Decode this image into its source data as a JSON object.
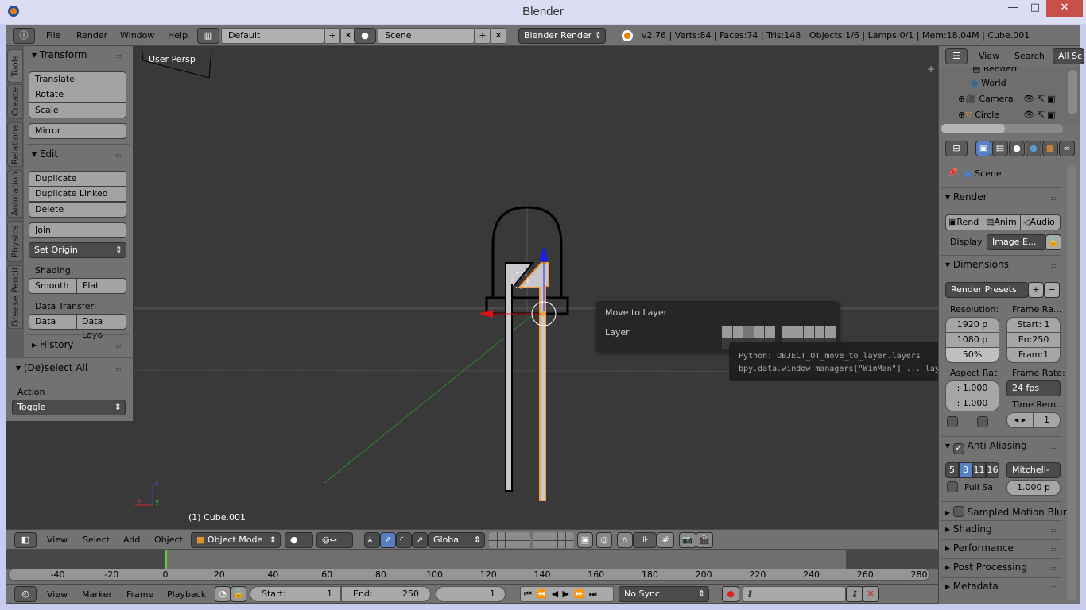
{
  "window": {
    "title": "Blender",
    "minimize": "—",
    "maximize": "□",
    "close": "✕"
  },
  "info_header": {
    "menus": [
      "File",
      "Render",
      "Window",
      "Help"
    ],
    "screen_layout": "Default",
    "scene": "Scene",
    "engine": "Blender Render",
    "stats": "v2.76 | Verts:84 | Faces:74 | Tris:148 | Objects:1/6 | Lamps:0/1 | Mem:18.04M | Cube.001"
  },
  "tool_tabs": [
    "Tools",
    "Create",
    "Relations",
    "Animation",
    "Physics",
    "Grease Pencil"
  ],
  "tool_shelf": {
    "transform": {
      "title": "Transform",
      "buttons": [
        "Translate",
        "Rotate",
        "Scale"
      ],
      "mirror": "Mirror"
    },
    "edit": {
      "title": "Edit",
      "buttons": [
        "Duplicate",
        "Duplicate Linked",
        "Delete"
      ],
      "join": "Join",
      "set_origin": "Set Origin",
      "shading_label": "Shading:",
      "shading": [
        "Smooth",
        "Flat"
      ],
      "data_transfer_label": "Data Transfer:",
      "data_transfer": [
        "Data",
        "Data Layo"
      ]
    },
    "history": "History"
  },
  "operator_panel": {
    "title": "(De)select All",
    "action_label": "Action",
    "action_value": "Toggle"
  },
  "viewport": {
    "view_label": "User Persp",
    "object_label": "(1) Cube.001",
    "axis_x": "x",
    "axis_y": "y",
    "axis_z": "z"
  },
  "move_to_layer": {
    "title": "Move to Layer",
    "layer_label": "Layer",
    "active_layer": 3
  },
  "tooltip": {
    "line1": "Python: OBJECT_OT_move_to_layer.layers",
    "line2": "bpy.data.window_managers[\"WinMan\"] ... layers"
  },
  "view3d_header": {
    "menus": [
      "View",
      "Select",
      "Add",
      "Object"
    ],
    "mode": "Object Mode",
    "orientation": "Global"
  },
  "timeline": {
    "ticks": [
      "-40",
      "-20",
      "0",
      "20",
      "40",
      "60",
      "80",
      "100",
      "120",
      "140",
      "160",
      "180",
      "200",
      "220",
      "240",
      "260",
      "280"
    ],
    "current_frame": 0,
    "header_menus": [
      "View",
      "Marker",
      "Frame",
      "Playback"
    ],
    "start_label": "Start:",
    "start": "1",
    "end_label": "End:",
    "end": "250",
    "frame": "1",
    "sync": "No Sync"
  },
  "outliner": {
    "menus": [
      "View",
      "Search"
    ],
    "filter": "All Sc",
    "items": [
      "RenderL",
      "World",
      "Camera",
      "Circle"
    ]
  },
  "properties": {
    "context": "Scene",
    "render": {
      "title": "Render",
      "buttons": [
        "Rend",
        "Anim",
        "Audio"
      ],
      "display_label": "Display",
      "display_value": "Image E..."
    },
    "dimensions": {
      "title": "Dimensions",
      "presets": "Render Presets",
      "resolution_label": "Resolution:",
      "res_x": "1920 p",
      "res_y": "1080 p",
      "res_pct": "50%",
      "frame_range_label": "Frame Ra...",
      "start": "Start: 1",
      "end": "En:250",
      "step": "Fram:1",
      "aspect_label": "Aspect Rat",
      "aspect_x": ": 1.000",
      "aspect_y": ": 1.000",
      "frame_rate_label": "Frame Rate:",
      "fps": "24 fps",
      "time_remap_label": "Time Rem...",
      "time_remap_value": "1"
    },
    "anti_aliasing": {
      "title": "Anti-Aliasing",
      "checked": true,
      "samples": [
        "5",
        "8",
        "11",
        "16"
      ],
      "selected_sample": "8",
      "filter": "Mitchell-",
      "full_sample": "Full Sa",
      "filter_size": "1.000 p"
    },
    "collapsed": [
      "Sampled Motion Blur",
      "Shading",
      "Performance",
      "Post Processing",
      "Metadata"
    ]
  },
  "colors": {
    "viewport_bg": "#393939",
    "panel_bg": "#727272",
    "selected_orange": "#f0a040",
    "active_blue": "#5680c2"
  }
}
